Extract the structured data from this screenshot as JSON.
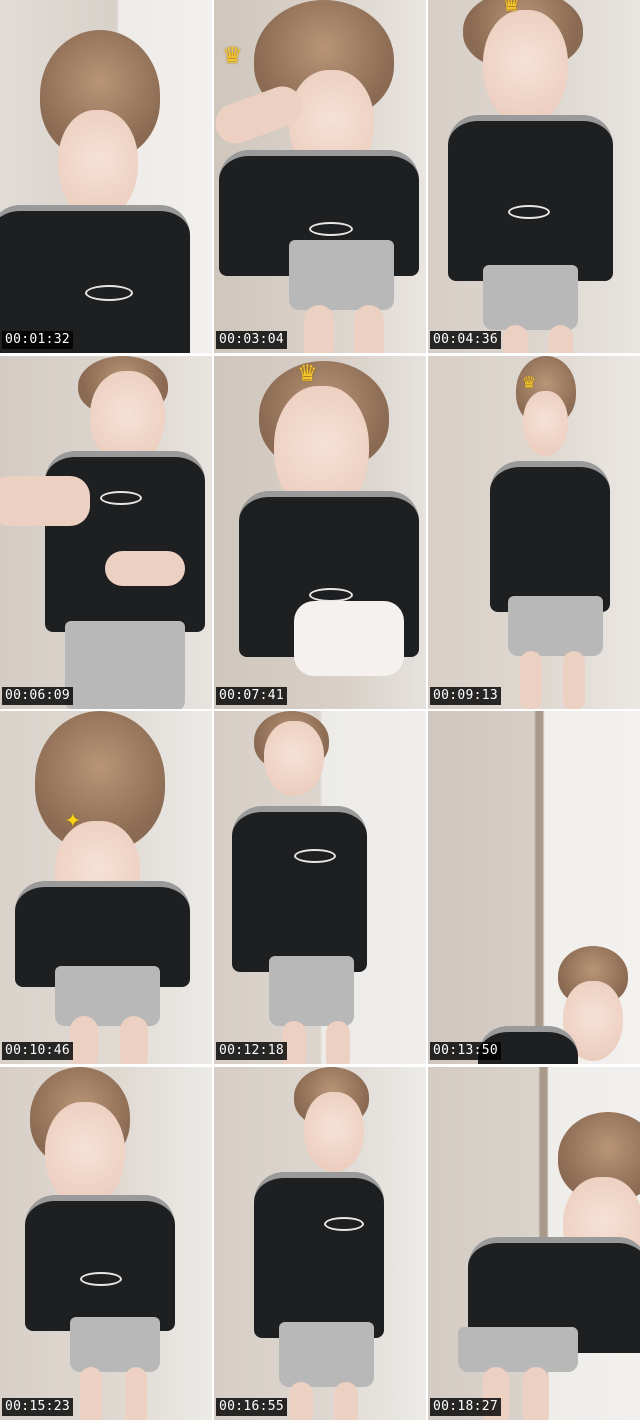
{
  "thumbnails": [
    {
      "timestamp": "00:01:32",
      "effect": ""
    },
    {
      "timestamp": "00:03:04",
      "effect": "crown"
    },
    {
      "timestamp": "00:04:36",
      "effect": "crown"
    },
    {
      "timestamp": "00:06:09",
      "effect": ""
    },
    {
      "timestamp": "00:07:41",
      "effect": "crown"
    },
    {
      "timestamp": "00:09:13",
      "effect": "crown"
    },
    {
      "timestamp": "00:10:46",
      "effect": "sparkle-halo"
    },
    {
      "timestamp": "00:12:18",
      "effect": ""
    },
    {
      "timestamp": "00:13:50",
      "effect": ""
    },
    {
      "timestamp": "00:15:23",
      "effect": ""
    },
    {
      "timestamp": "00:16:55",
      "effect": ""
    },
    {
      "timestamp": "00:18:27",
      "effect": ""
    }
  ],
  "colors": {
    "background": "#ffffff",
    "stamp_bg": "#000000",
    "stamp_text": "#ffffff",
    "shirt": "#1e1f21",
    "shorts": "#b8b8b8",
    "wall": "#d9d3cc"
  }
}
